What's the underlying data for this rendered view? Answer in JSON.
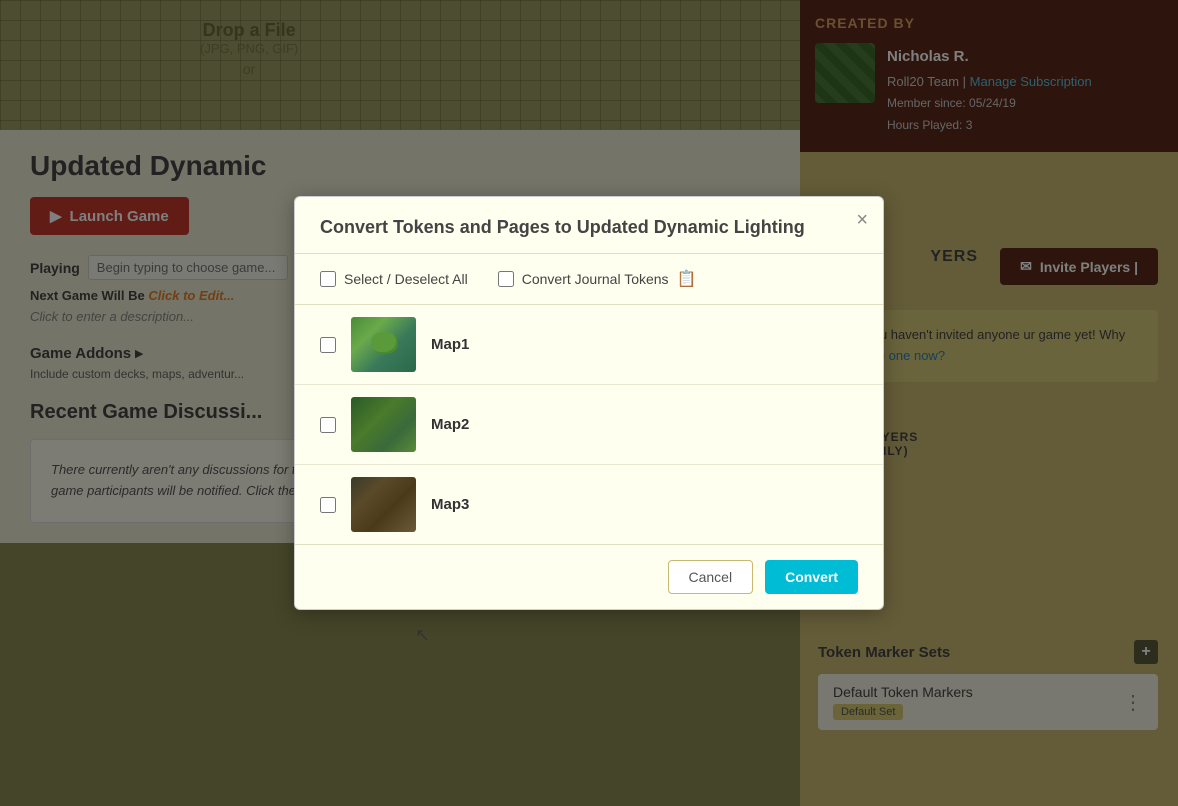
{
  "modal": {
    "title": "Convert Tokens and Pages to Updated Dynamic Lighting",
    "close_label": "×",
    "select_all_label": "Select / Deselect All",
    "convert_journal_label": "Convert Journal Tokens",
    "cancel_label": "Cancel",
    "convert_label": "Convert",
    "maps": [
      {
        "name": "Map1",
        "id": "map1"
      },
      {
        "name": "Map2",
        "id": "map2"
      },
      {
        "name": "Map3",
        "id": "map3"
      }
    ]
  },
  "left": {
    "drop_file": "Drop a File",
    "drop_formats": "(JPG, PNG, GIF)",
    "drop_or": "or",
    "page_title": "Updated Dynamic",
    "launch_game": "Launch Game",
    "playing_label": "Playing",
    "playing_placeholder": "Begin typing to choose game...",
    "next_game_label": "Next Game Will Be",
    "next_game_value": "Click to Edit...",
    "description": "Click to enter a description...",
    "game_addons": "Game Addons ▸",
    "game_addons_sub": "Include custom decks, maps, adventur...",
    "recent_discussion": "Recent Game Discussi...",
    "discussion_text": "There currently aren't any discussions for this game. Game discussions allow you to communicate out of the game; all game participants will be notified. Click the \"Post New Topic\" button above to start a discussion."
  },
  "right": {
    "created_by_title": "CREATED BY",
    "creator_name": "Nicholas R.",
    "creator_team": "Roll20 Team |",
    "creator_manage": "Manage Subscription",
    "creator_member": "Member since: 05/24/19",
    "creator_hours": "Hours Played: 3",
    "players_title": "YERS",
    "invite_btn": "Invite Players |",
    "no_invite_text": "s like you haven't invited anyone ur game yet! Why not",
    "invite_link": "invite one now?",
    "previous_players": "IOUS PLAYERS\nN/MOD ONLY)",
    "token_marker_title": "Token Marker Sets",
    "add_icon": "+",
    "default_marker": "Default Token Markers",
    "default_badge": "Default Set",
    "more_icon": "⋮"
  },
  "colors": {
    "accent": "#c0392b",
    "header_bg": "#5a2a1a",
    "right_panel_bg": "#c8b870",
    "modal_bg": "#fffff0",
    "convert_btn": "#00bcd4",
    "cancel_border": "#c8b870"
  }
}
